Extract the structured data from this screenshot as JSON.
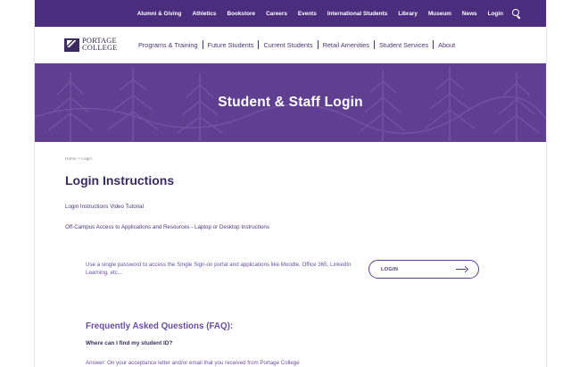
{
  "utility_nav": {
    "items": [
      "Alumni & Giving",
      "Athletics",
      "Bookstore",
      "Careers",
      "Events",
      "International Students",
      "Library",
      "Museum",
      "News",
      "Login"
    ]
  },
  "logo": {
    "line1": "PORTAGE",
    "line2": "COLLEGE"
  },
  "main_nav": {
    "items": [
      "Programs & Training",
      "Future Students",
      "Current Students",
      "Retail Amenities",
      "Student Services",
      "About"
    ]
  },
  "hero": {
    "title": "Student & Staff Login"
  },
  "breadcrumb": "Home  >  Login",
  "page_title": "Login Instructions",
  "links": {
    "video_tutorial": "Login Instructions Video Tutorial",
    "off_campus": "Off-Campus Access to Applications and Resources - Laptop or Desktop Instructions"
  },
  "sso": {
    "text": "Use a single password to access the Single Sign-on portal and applications like Moodle, Office 365, LinkedIn Learning, etc...",
    "button_label": "LOGIN"
  },
  "faq": {
    "heading": "Frequently Asked Questions (FAQ):",
    "question_1": "Where can I find my student ID?",
    "answer_1": "Answer: On your acceptance letter and/or email that you received from Portage College"
  },
  "colors": {
    "brand_purple": "#4a2d7c",
    "hero_purple": "#5f3f8f",
    "text_dark": "#3b2a60",
    "text_link": "#6c4fa0"
  }
}
